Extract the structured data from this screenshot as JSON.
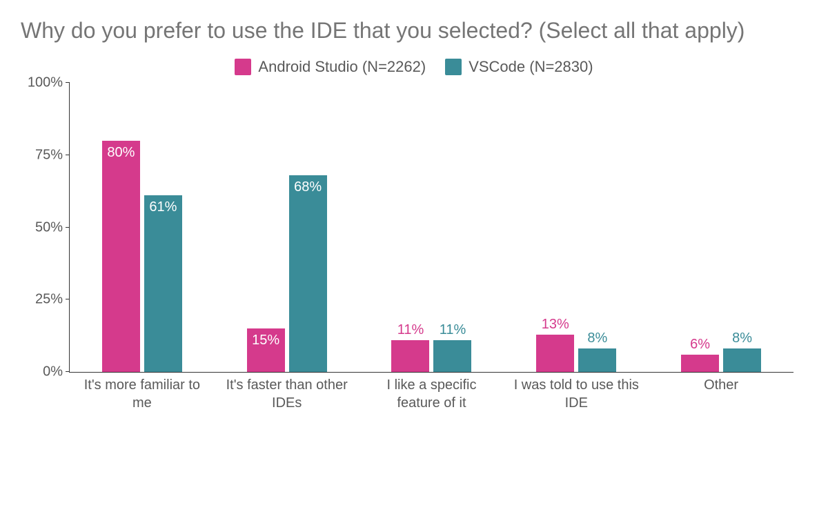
{
  "chart_data": {
    "type": "bar",
    "title": "Why do you prefer to use the IDE that you selected? (Select all that apply)",
    "xlabel": "",
    "ylabel": "",
    "ylim": [
      0,
      100
    ],
    "yticks": [
      0,
      25,
      50,
      75,
      100
    ],
    "ytick_labels": [
      "0%",
      "25%",
      "50%",
      "75%",
      "100%"
    ],
    "categories": [
      "It's more familiar to me",
      "It's faster than other IDEs",
      "I like a specific feature of it",
      "I was told to use this IDE",
      "Other"
    ],
    "series": [
      {
        "name": "Android Studio (N=2262)",
        "color": "#d53a8c",
        "values": [
          80,
          15,
          11,
          13,
          6
        ]
      },
      {
        "name": "VSCode (N=2830)",
        "color": "#3a8c98",
        "values": [
          61,
          68,
          11,
          8,
          8
        ]
      }
    ],
    "value_suffix": "%",
    "label_inside_threshold": 14
  }
}
